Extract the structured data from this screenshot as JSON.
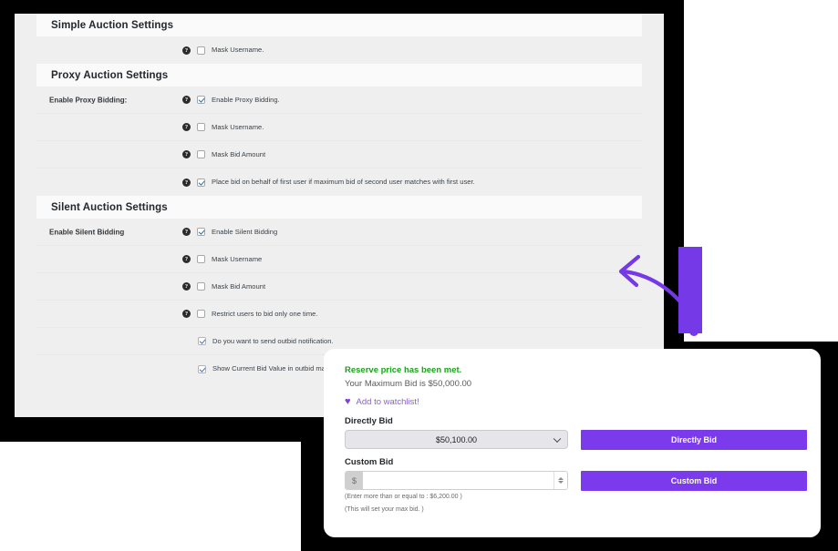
{
  "settings_panel": {
    "sections": [
      {
        "title": "Simple Auction Settings",
        "rows": [
          {
            "label": "",
            "help": "?",
            "checked": false,
            "text": "Mask Username."
          }
        ]
      },
      {
        "title": "Proxy Auction Settings",
        "rows": [
          {
            "label": "Enable Proxy Bidding:",
            "help": "?",
            "checked": true,
            "text": "Enable Proxy Bidding."
          },
          {
            "label": "",
            "help": "?",
            "checked": false,
            "text": "Mask Username."
          },
          {
            "label": "",
            "help": "?",
            "checked": false,
            "text": "Mask Bid Amount"
          },
          {
            "label": "",
            "help": "?",
            "checked": true,
            "text": "Place bid on behalf of first user if maximum bid of second user matches with first user."
          }
        ]
      },
      {
        "title": "Silent Auction Settings",
        "rows": [
          {
            "label": "Enable Silent Bidding",
            "help": "?",
            "checked": true,
            "text": "Enable Silent Bidding"
          },
          {
            "label": "",
            "help": "?",
            "checked": false,
            "text": "Mask Username"
          },
          {
            "label": "",
            "help": "?",
            "checked": false,
            "text": "Mask Bid Amount"
          },
          {
            "label": "",
            "help": "?",
            "checked": false,
            "text": "Restrict users to bid only one time."
          },
          {
            "label": "",
            "help": null,
            "checked": true,
            "text": "Do you want to send outbid notification."
          },
          {
            "label": "",
            "help": null,
            "checked": true,
            "text": "Show Current Bid Value in outbid mail."
          }
        ]
      }
    ]
  },
  "bid_card": {
    "reserve_status": "Reserve price has been met.",
    "max_bid_line": "Your Maximum Bid is $50,000.00",
    "watchlist": {
      "icon": "heart-icon",
      "glyph": "♥",
      "label": "Add to watchlist!"
    },
    "directly_bid": {
      "field_label": "Directly Bid",
      "selected_value": "$50,100.00",
      "options": [
        "$50,100.00"
      ],
      "button_label": "Directly Bid",
      "caret_icon": "chevron-down-icon"
    },
    "custom_bid": {
      "field_label": "Custom Bid",
      "currency_prefix": "$",
      "input_value": "",
      "input_placeholder": "",
      "button_label": "Custom Bid",
      "hint_min": "(Enter more than or equal to : $6,200.00 )",
      "hint_max": "(This will set your max bid. )"
    }
  },
  "decor": {
    "arrow_icon": "curved-arrow-left-icon",
    "accent_color": "#7639e8",
    "purple_button_color": "#7c3aed",
    "green_status_color": "#1ea11e",
    "watchlist_link_color": "#8a5fd6",
    "backdrop_color": "#000000"
  }
}
